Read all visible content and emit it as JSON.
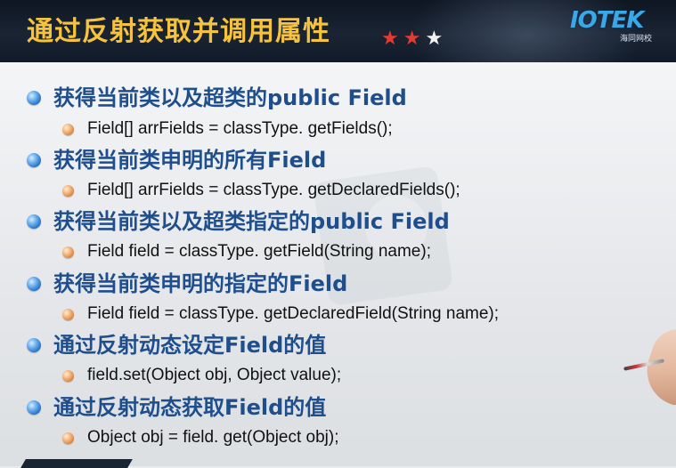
{
  "header": {
    "title": "通过反射获取并调用属性",
    "stars": [
      "★",
      "★",
      "★"
    ],
    "star_colors": [
      "#e63a2e",
      "#e63a2e",
      "#f2f2f2"
    ]
  },
  "logo": {
    "main": "IOTEK",
    "sub": "海同网校"
  },
  "items": [
    {
      "text": "获得当前类以及超类的public Field",
      "sub": "Field[] arrFields = classType. getFields();"
    },
    {
      "text": "获得当前类申明的所有Field",
      "sub": "Field[] arrFields = classType. getDeclaredFields();"
    },
    {
      "text": "获得当前类以及超类指定的public Field",
      "sub": "Field field = classType. getField(String name);"
    },
    {
      "text": "获得当前类申明的指定的Field",
      "sub": "Field field = classType. getDeclaredField(String name);"
    },
    {
      "text": "通过反射动态设定Field的值",
      "sub": "field.set(Object obj, Object value);"
    },
    {
      "text": "通过反射动态获取Field的值",
      "sub": "Object obj = field. get(Object obj);"
    }
  ],
  "colors": {
    "title": "#f6c340",
    "level1_text": "#1f4e8c",
    "level2_text": "#111111",
    "logo": "#3aa7e6"
  }
}
